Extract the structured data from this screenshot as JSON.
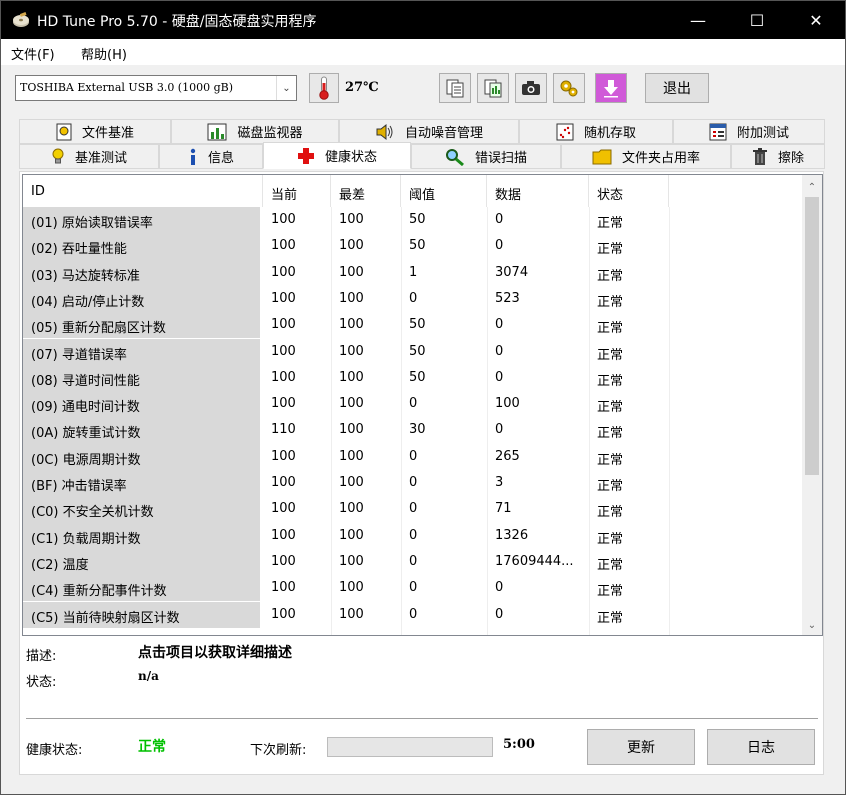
{
  "window": {
    "title": "HD Tune Pro 5.70 - 硬盘/固态硬盘实用程序",
    "minimize": "—",
    "maximize": "☐",
    "close": "✕"
  },
  "menu": {
    "file": "文件(F)",
    "help": "帮助(H)"
  },
  "toolbar": {
    "drive": "TOSHIBA External USB 3.0 (1000 gB)",
    "temperature": "27℃",
    "exit_label": "退出",
    "icons": [
      "copy-text-icon",
      "copy-screenshot-icon",
      "camera-icon",
      "settings-icon",
      "download-icon"
    ]
  },
  "tabs": {
    "row1": [
      "文件基准",
      "磁盘监视器",
      "自动噪音管理",
      "随机存取",
      "附加测试"
    ],
    "row2": [
      "基准测试",
      "信息",
      "健康状态",
      "错误扫描",
      "文件夹占用率",
      "擦除"
    ],
    "active": "健康状态"
  },
  "table": {
    "headers": [
      "ID",
      "当前",
      "最差",
      "阈值",
      "数据",
      "状态"
    ],
    "rows": [
      [
        "(01) 原始读取错误率",
        "100",
        "100",
        "50",
        "0",
        "正常"
      ],
      [
        "(02) 吞吐量性能",
        "100",
        "100",
        "50",
        "0",
        "正常"
      ],
      [
        "(03) 马达旋转标准",
        "100",
        "100",
        "1",
        "3074",
        "正常"
      ],
      [
        "(04) 启动/停止计数",
        "100",
        "100",
        "0",
        "523",
        "正常"
      ],
      [
        "(05) 重新分配扇区计数",
        "100",
        "100",
        "50",
        "0",
        "正常"
      ],
      [
        "(07) 寻道错误率",
        "100",
        "100",
        "50",
        "0",
        "正常"
      ],
      [
        "(08) 寻道时间性能",
        "100",
        "100",
        "50",
        "0",
        "正常"
      ],
      [
        "(09) 通电时间计数",
        "100",
        "100",
        "0",
        "100",
        "正常"
      ],
      [
        "(0A) 旋转重试计数",
        "110",
        "100",
        "30",
        "0",
        "正常"
      ],
      [
        "(0C) 电源周期计数",
        "100",
        "100",
        "0",
        "265",
        "正常"
      ],
      [
        "(BF) 冲击错误率",
        "100",
        "100",
        "0",
        "3",
        "正常"
      ],
      [
        "(C0) 不安全关机计数",
        "100",
        "100",
        "0",
        "71",
        "正常"
      ],
      [
        "(C1) 负载周期计数",
        "100",
        "100",
        "0",
        "1326",
        "正常"
      ],
      [
        "(C2) 温度",
        "100",
        "100",
        "0",
        "17609444...",
        "正常"
      ],
      [
        "(C4) 重新分配事件计数",
        "100",
        "100",
        "0",
        "0",
        "正常"
      ],
      [
        "(C5) 当前待映射扇区计数",
        "100",
        "100",
        "0",
        "0",
        "正常"
      ]
    ]
  },
  "details": {
    "desc_label": "描述:",
    "desc_value": "点击项目以获取详细描述",
    "status_label": "状态:",
    "status_value": "n/a"
  },
  "footer": {
    "health_label": "健康状态:",
    "health_value": "正常",
    "health_color": "#00c000",
    "next_refresh_label": "下次刷新:",
    "countdown": "5:00",
    "refresh_label": "更新",
    "log_label": "日志"
  }
}
